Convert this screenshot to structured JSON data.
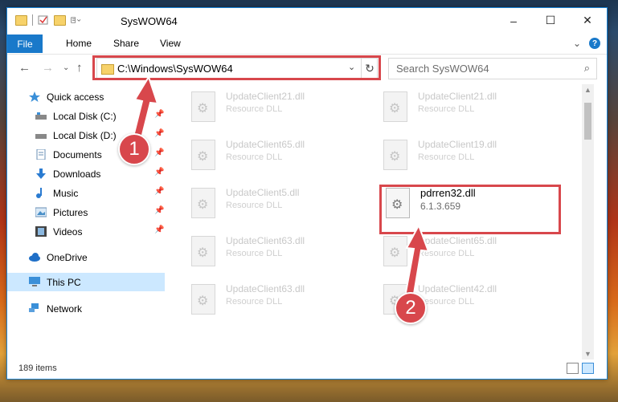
{
  "window": {
    "title": "SysWOW64",
    "controls": {
      "minimize": "–",
      "maximize": "☐",
      "close": "✕"
    }
  },
  "ribbon": {
    "file_tab": "File",
    "tabs": [
      "Home",
      "Share",
      "View"
    ],
    "expand_icon": "⌄",
    "help": "?"
  },
  "nav": {
    "back": "←",
    "forward": "→",
    "recent": "⌄",
    "up": "↑",
    "address": "C:\\Windows\\SysWOW64",
    "address_dropdown": "⌄",
    "refresh": "↻",
    "search_placeholder": "Search SysWOW64",
    "search_icon": "⌕"
  },
  "sidebar": {
    "items": [
      {
        "label": "Quick access",
        "icon": "star-icon"
      },
      {
        "label": "Local Disk (C:)",
        "icon": "drive-icon",
        "pinned": true
      },
      {
        "label": "Local Disk (D:)",
        "icon": "drive-icon",
        "pinned": true
      },
      {
        "label": "Documents",
        "icon": "documents-icon",
        "pinned": true
      },
      {
        "label": "Downloads",
        "icon": "downloads-icon",
        "pinned": true
      },
      {
        "label": "Music",
        "icon": "music-icon",
        "pinned": true
      },
      {
        "label": "Pictures",
        "icon": "pictures-icon",
        "pinned": true
      },
      {
        "label": "Videos",
        "icon": "videos-icon",
        "pinned": true
      },
      {
        "label": "OneDrive",
        "icon": "cloud-icon"
      },
      {
        "label": "This PC",
        "icon": "computer-icon",
        "selected": true
      },
      {
        "label": "Network",
        "icon": "network-icon"
      }
    ],
    "pin_glyph": "📌"
  },
  "files": [
    {
      "name": "UpdateClient21.dll",
      "type": "Resource DLL"
    },
    {
      "name": "UpdateClient21.dll",
      "type": "Resource DLL"
    },
    {
      "name": "UpdateClient65.dll",
      "type": "Resource DLL"
    },
    {
      "name": "UpdateClient19.dll",
      "type": "Resource DLL"
    },
    {
      "name": "UpdateClient5.dll",
      "type": "Resource DLL"
    },
    {
      "name": "pdrren32.dll",
      "type": "6.1.3.659"
    },
    {
      "name": "UpdateClient63.dll",
      "type": "Resource DLL"
    },
    {
      "name": "UpdateClient65.dll",
      "type": "Resource DLL"
    },
    {
      "name": "UpdateClient63.dll",
      "type": "Resource DLL"
    },
    {
      "name": "UpdateClient42.dll",
      "type": "Resource DLL"
    }
  ],
  "status": {
    "item_count": "189 items"
  },
  "annotations": {
    "badge1": "1",
    "badge2": "2",
    "highlight_color": "#d8474c"
  },
  "colors": {
    "accent": "#1979ca",
    "selection": "#cce8ff"
  }
}
